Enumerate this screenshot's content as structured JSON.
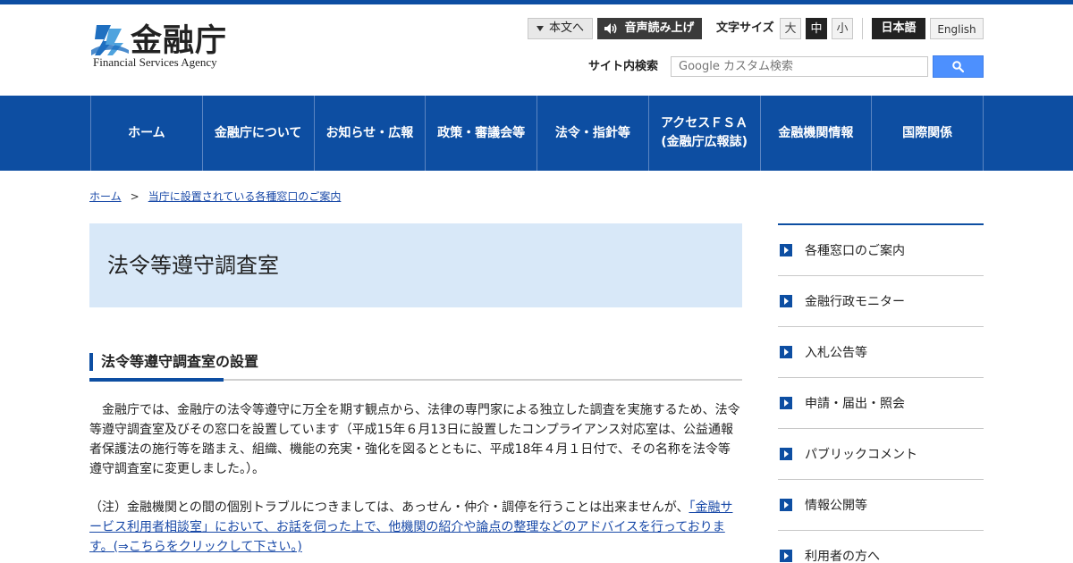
{
  "header": {
    "logo_name": "金融庁",
    "logo_en": "Financial Services Agency",
    "skip_label": "本文へ",
    "voice_label": "音声読み上げ",
    "font_size_label": "文字サイズ",
    "font_sizes": [
      "大",
      "中",
      "小"
    ],
    "lang_ja": "日本語",
    "lang_en": "English",
    "search_label": "サイト内検索",
    "search_placeholder": "Google カスタム検索"
  },
  "gnav": [
    {
      "label": "ホーム"
    },
    {
      "label": "金融庁について"
    },
    {
      "label": "お知らせ・広報"
    },
    {
      "label": "政策・審議会等"
    },
    {
      "label": "法令・指針等"
    },
    {
      "label": "アクセスＦＳＡ",
      "sub": "(金融庁広報誌)"
    },
    {
      "label": "金融機関情報"
    },
    {
      "label": "国際関係"
    }
  ],
  "breadcrumb": {
    "home": "ホーム",
    "separator": ">",
    "current": "当庁に設置されている各種窓口のご案内"
  },
  "page": {
    "title": "法令等遵守調査室",
    "section_heading": "法令等遵守調査室の設置",
    "paragraph1": "　金融庁では、金融庁の法令等遵守に万全を期す観点から、法律の専門家による独立した調査を実施するため、法令等遵守調査室及びその窓口を設置しています（平成15年６月13日に設置したコンプライアンス対応室は、公益通報者保護法の施行等を踏まえ、組織、機能の充実・強化を図るとともに、平成18年４月１日付で、その名称を法令等遵守調査室に変更しました。）。",
    "paragraph2_text": "（注）金融機関との間の個別トラブルにつきましては、あっせん・仲介・調停を行うことは出来ませんが、",
    "paragraph2_link": "「金融サービス利用者相談室」において、お話を伺った上で、他機関の紹介や論点の整理などのアドバイスを行っております。(⇒こちらをクリックして下さい。)"
  },
  "sidebar": {
    "items": [
      {
        "label": "各種窓口のご案内"
      },
      {
        "label": "金融行政モニター"
      },
      {
        "label": "入札公告等"
      },
      {
        "label": "申請・届出・照会"
      },
      {
        "label": "パブリックコメント"
      },
      {
        "label": "情報公開等"
      },
      {
        "label": "利用者の方へ"
      }
    ]
  },
  "colors": {
    "brand_blue": "#0d4ea2",
    "title_bg": "#d8e8f8",
    "link": "#1a4aa8"
  },
  "icons": {
    "skip": "triangle-down-icon",
    "voice": "speaker-icon",
    "search": "magnifier-icon",
    "sidebar": "arrow-right-square-icon"
  }
}
